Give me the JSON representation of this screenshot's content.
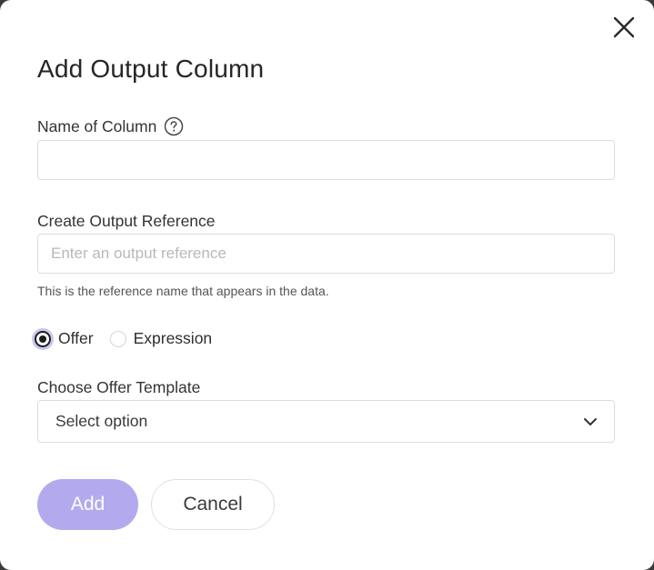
{
  "dialog": {
    "title": "Add Output Column",
    "close_icon": "close-icon"
  },
  "column_name": {
    "label": "Name of Column",
    "help_icon": "question-circle-icon",
    "value": "",
    "placeholder": ""
  },
  "output_reference": {
    "label": "Create Output Reference",
    "value": "",
    "placeholder": "Enter an output reference",
    "hint": "This is the reference name that appears in the data."
  },
  "type_selector": {
    "options": [
      {
        "label": "Offer",
        "checked": true
      },
      {
        "label": "Expression",
        "checked": false
      }
    ]
  },
  "offer_template": {
    "label": "Choose Offer Template",
    "selected": "Select option",
    "chevron_icon": "chevron-down-icon"
  },
  "actions": {
    "add_label": "Add",
    "cancel_label": "Cancel"
  },
  "colors": {
    "accent": "#b3aaee",
    "radio_focus_ring": "#c9c7f2"
  }
}
